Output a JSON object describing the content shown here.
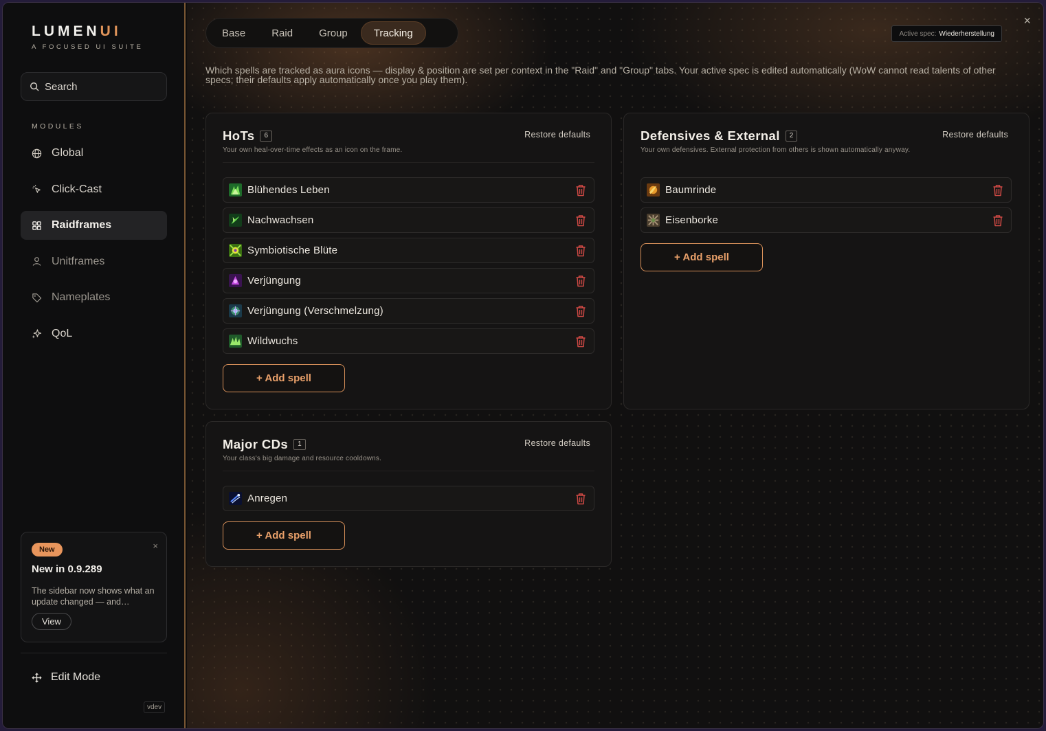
{
  "app": {
    "logo_main": "LUMEN",
    "logo_accent": "UI",
    "tagline": "A FOCUSED UI SUITE"
  },
  "sidebar": {
    "search_placeholder": "Search",
    "modules_label": "MODULES",
    "items": [
      {
        "label": "Global",
        "icon": "globe-icon",
        "state": "normal"
      },
      {
        "label": "Click-Cast",
        "icon": "click-icon",
        "state": "normal"
      },
      {
        "label": "Raidframes",
        "icon": "grid-icon",
        "state": "active"
      },
      {
        "label": "Unitframes",
        "icon": "user-icon",
        "state": "dim"
      },
      {
        "label": "Nameplates",
        "icon": "tag-icon",
        "state": "dim"
      },
      {
        "label": "QoL",
        "icon": "sparkles-icon",
        "state": "normal"
      }
    ],
    "news": {
      "badge": "New",
      "close": "×",
      "title": "New in 0.9.289",
      "body": "The sidebar now shows what an update changed — and…",
      "button": "View"
    },
    "edit_mode": "Edit Mode",
    "version": "vdev"
  },
  "header": {
    "tabs": [
      {
        "label": "Base",
        "active": false
      },
      {
        "label": "Raid",
        "active": false
      },
      {
        "label": "Group",
        "active": false
      },
      {
        "label": "Tracking",
        "active": true
      }
    ],
    "active_spec_label": "Active spec:",
    "active_spec_value": "Wiederherstellung",
    "close": "×"
  },
  "intro": "Which spells are tracked as aura icons — display & position are set per context in the \"Raid\" and \"Group\" tabs. Your active spec is edited automatically (WoW cannot read talents of other specs; their defaults apply automatically once you play them).",
  "cards": {
    "hots": {
      "title": "HoTs",
      "count": "6",
      "subtitle": "Your own heal-over-time effects as an icon on the frame.",
      "restore": "Restore defaults",
      "spells": [
        "Blühendes Leben",
        "Nachwachsen",
        "Symbiotische Blüte",
        "Verjüngung",
        "Verjüngung (Verschmelzung)",
        "Wildwuchs"
      ],
      "add": "+ Add spell"
    },
    "defensives": {
      "title": "Defensives & External",
      "count": "2",
      "subtitle": "Your own defensives. External protection from others is shown automatically anyway.",
      "restore": "Restore defaults",
      "spells": [
        "Baumrinde",
        "Eisenborke"
      ],
      "add": "+ Add spell"
    },
    "major": {
      "title": "Major CDs",
      "count": "1",
      "subtitle": "Your class's big damage and resource cooldowns.",
      "restore": "Restore defaults",
      "spells": [
        "Anregen"
      ],
      "add": "+ Add spell"
    }
  },
  "colors": {
    "accent": "#e0945a",
    "trash": "#d24a45",
    "sidebar_border": "#7a5733"
  }
}
